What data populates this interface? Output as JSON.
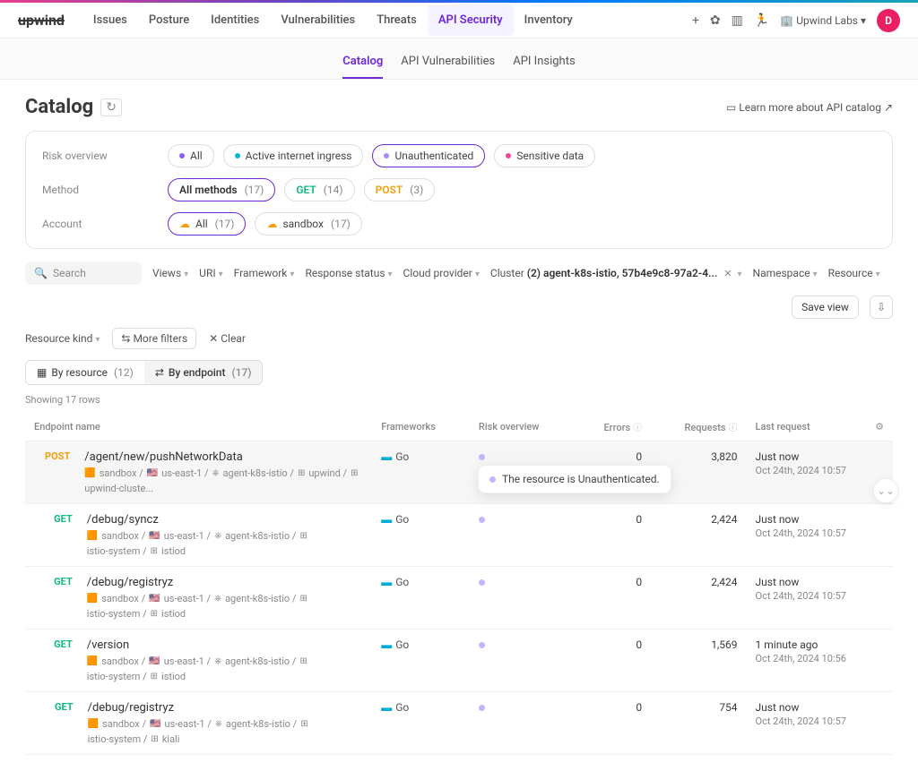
{
  "brand": "upwind",
  "nav": {
    "items": [
      "Issues",
      "Posture",
      "Identities",
      "Vulnerabilities",
      "Threats",
      "API Security",
      "Inventory"
    ],
    "active": 5,
    "org": "Upwind Labs",
    "avatar": "D"
  },
  "subnav": {
    "items": [
      "Catalog",
      "API Vulnerabilities",
      "API Insights"
    ],
    "active": 0
  },
  "page_title": "Catalog",
  "learn_more": "Learn more about API catalog",
  "filters": {
    "risk_label": "Risk overview",
    "risk_pills": [
      {
        "label": "All",
        "icon_color": "#8b5cf6",
        "selected": false
      },
      {
        "label": "Active internet ingress",
        "icon_color": "#06b6d4",
        "selected": false
      },
      {
        "label": "Unauthenticated",
        "icon_color": "#a78bfa",
        "selected": true
      },
      {
        "label": "Sensitive data",
        "icon_color": "#ec4899",
        "selected": false
      }
    ],
    "method_label": "Method",
    "method_pills": [
      {
        "label": "All methods",
        "count": "(17)",
        "color": "#333",
        "selected": true
      },
      {
        "label": "GET",
        "count": "(14)",
        "color": "#10b981",
        "selected": false
      },
      {
        "label": "POST",
        "count": "(3)",
        "color": "#f59e0b",
        "selected": false
      }
    ],
    "account_label": "Account",
    "account_pills": [
      {
        "label": "All",
        "count": "(17)",
        "color": "#333",
        "icon": "☁",
        "selected": true
      },
      {
        "label": "sandbox",
        "count": "(17)",
        "color": "#555",
        "icon": "☁",
        "selected": false
      }
    ]
  },
  "controls": {
    "search_placeholder": "Search",
    "dropdowns": [
      "Views",
      "URI",
      "Framework",
      "Response status",
      "Cloud provider"
    ],
    "cluster_label": "Cluster",
    "cluster_value": "(2) agent-k8s-istio, 57b4e9c8-97a2-4...",
    "dropdowns2": [
      "Namespace",
      "Resource"
    ],
    "save_view": "Save view",
    "resource_kind": "Resource kind",
    "more_filters": "More filters",
    "clear": "Clear"
  },
  "view_tabs": {
    "by_resource": {
      "label": "By resource",
      "count": "(12)"
    },
    "by_endpoint": {
      "label": "By endpoint",
      "count": "(17)",
      "active": true
    }
  },
  "row_count": "Showing 17 rows",
  "columns": {
    "endpoint": "Endpoint name",
    "frameworks": "Frameworks",
    "risk": "Risk overview",
    "errors": "Errors",
    "requests": "Requests",
    "last": "Last request"
  },
  "tooltip": "The resource is Unauthenticated.",
  "rows": [
    {
      "method": "POST",
      "path": "/agent/new/pushNetworkData",
      "crumbs": [
        "sandbox",
        "us-east-1",
        "agent-k8s-istio",
        "upwind",
        "upwind-cluste..."
      ],
      "framework": "Go",
      "errors": "0",
      "requests": "3,820",
      "last": "Just now",
      "last_sub": "Oct 24th, 2024 10:57",
      "selected": true
    },
    {
      "method": "GET",
      "path": "/debug/syncz",
      "crumbs": [
        "sandbox",
        "us-east-1",
        "agent-k8s-istio",
        "istio-system",
        "istiod"
      ],
      "framework": "Go",
      "errors": "0",
      "requests": "2,424",
      "last": "Just now",
      "last_sub": "Oct 24th, 2024 10:57"
    },
    {
      "method": "GET",
      "path": "/debug/registryz",
      "crumbs": [
        "sandbox",
        "us-east-1",
        "agent-k8s-istio",
        "istio-system",
        "istiod"
      ],
      "framework": "Go",
      "errors": "0",
      "requests": "2,424",
      "last": "Just now",
      "last_sub": "Oct 24th, 2024 10:57"
    },
    {
      "method": "GET",
      "path": "/version",
      "crumbs": [
        "sandbox",
        "us-east-1",
        "agent-k8s-istio",
        "istio-system",
        "istiod"
      ],
      "framework": "Go",
      "errors": "0",
      "requests": "1,569",
      "last": "1 minute ago",
      "last_sub": "Oct 24th, 2024 10:56"
    },
    {
      "method": "GET",
      "path": "/debug/registryz",
      "crumbs": [
        "sandbox",
        "us-east-1",
        "agent-k8s-istio",
        "istio-system",
        "kiali"
      ],
      "framework": "Go",
      "errors": "0",
      "requests": "754",
      "last": "Just now",
      "last_sub": "Oct 24th, 2024 10:57"
    }
  ]
}
